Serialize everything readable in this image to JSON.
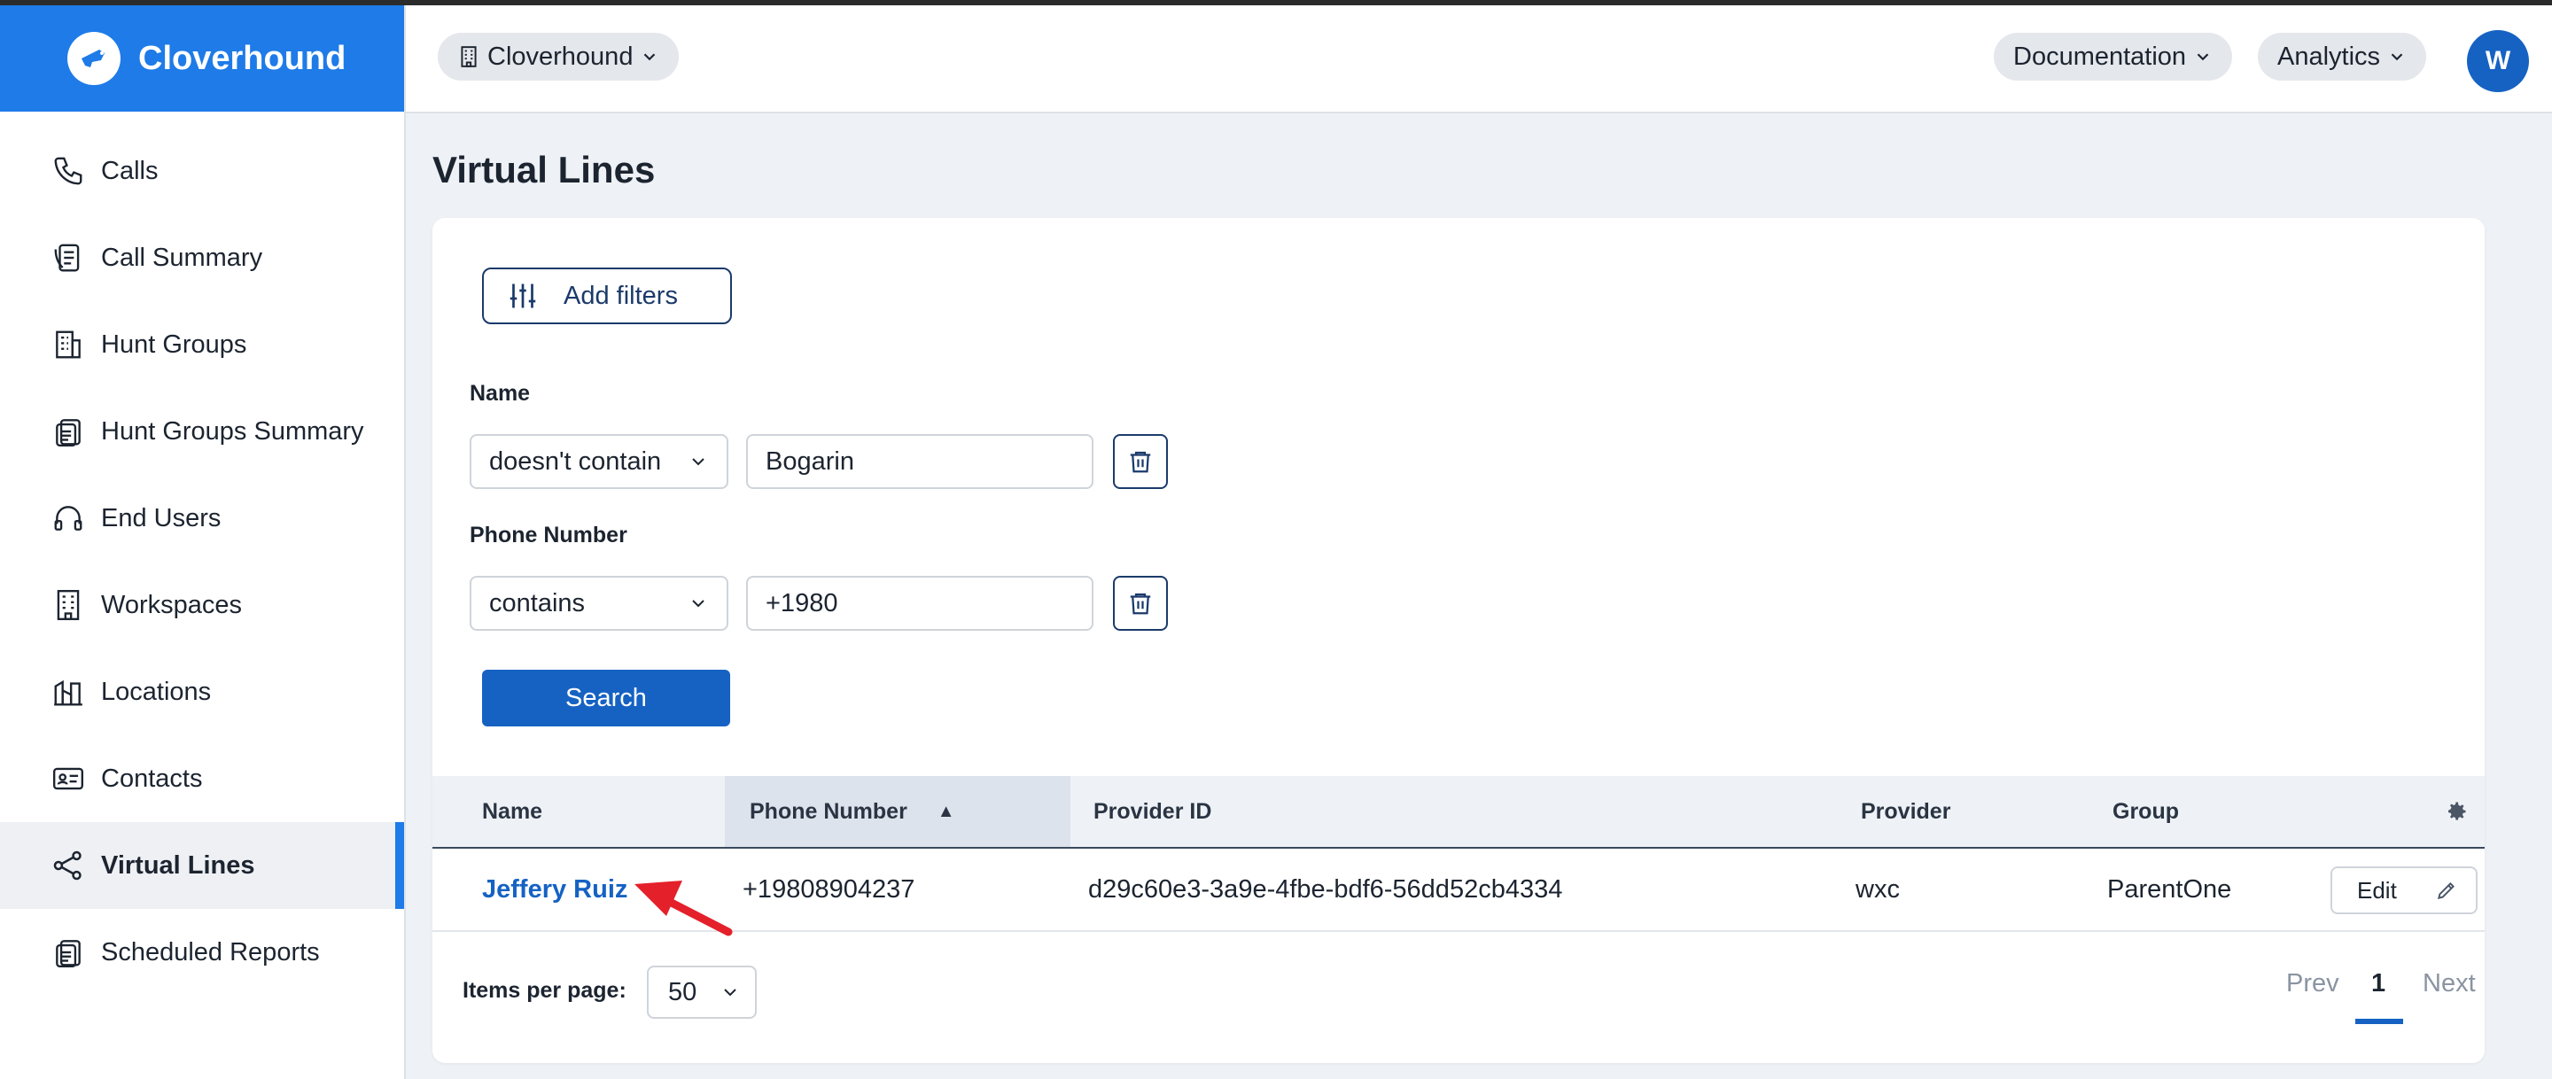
{
  "app": {
    "name": "Cloverhound"
  },
  "sidebar": {
    "items": [
      {
        "label": "Calls",
        "icon": "phone-icon"
      },
      {
        "label": "Call Summary",
        "icon": "call-summary-icon"
      },
      {
        "label": "Hunt Groups",
        "icon": "building-icon"
      },
      {
        "label": "Hunt Groups Summary",
        "icon": "clipboard-icon"
      },
      {
        "label": "End Users",
        "icon": "headset-icon"
      },
      {
        "label": "Workspaces",
        "icon": "workspace-building-icon"
      },
      {
        "label": "Locations",
        "icon": "city-icon"
      },
      {
        "label": "Contacts",
        "icon": "contact-card-icon"
      },
      {
        "label": "Virtual Lines",
        "icon": "share-nodes-icon",
        "active": true
      },
      {
        "label": "Scheduled Reports",
        "icon": "report-clipboard-icon"
      }
    ]
  },
  "header": {
    "org_label": "Cloverhound",
    "documentation_label": "Documentation",
    "analytics_label": "Analytics",
    "avatar_initial": "W"
  },
  "page": {
    "title": "Virtual Lines"
  },
  "filters": {
    "add_filters_label": "Add filters",
    "name": {
      "label": "Name",
      "operator": "doesn't contain",
      "value": "Bogarin"
    },
    "phone": {
      "label": "Phone Number",
      "operator": "contains",
      "value": "+1980"
    },
    "search_label": "Search"
  },
  "table": {
    "columns": {
      "name": "Name",
      "phone": "Phone Number",
      "provider_id": "Provider ID",
      "provider": "Provider",
      "group": "Group"
    },
    "sort_indicator": "▲",
    "rows": [
      {
        "name": "Jeffery Ruiz",
        "phone": "+19808904237",
        "provider_id": "d29c60e3-3a9e-4fbe-bdf6-56dd52cb4334",
        "provider": "wxc",
        "group": "ParentOne",
        "edit_label": "Edit"
      }
    ]
  },
  "pagination": {
    "items_per_page_label": "Items per page:",
    "items_per_page_value": "50",
    "prev_label": "Prev",
    "current_page": "1",
    "next_label": "Next"
  },
  "colors": {
    "brand": "#1e7be8",
    "primary_button": "#1562c3",
    "link": "#1562c3",
    "annotation_arrow": "#e4202a"
  }
}
